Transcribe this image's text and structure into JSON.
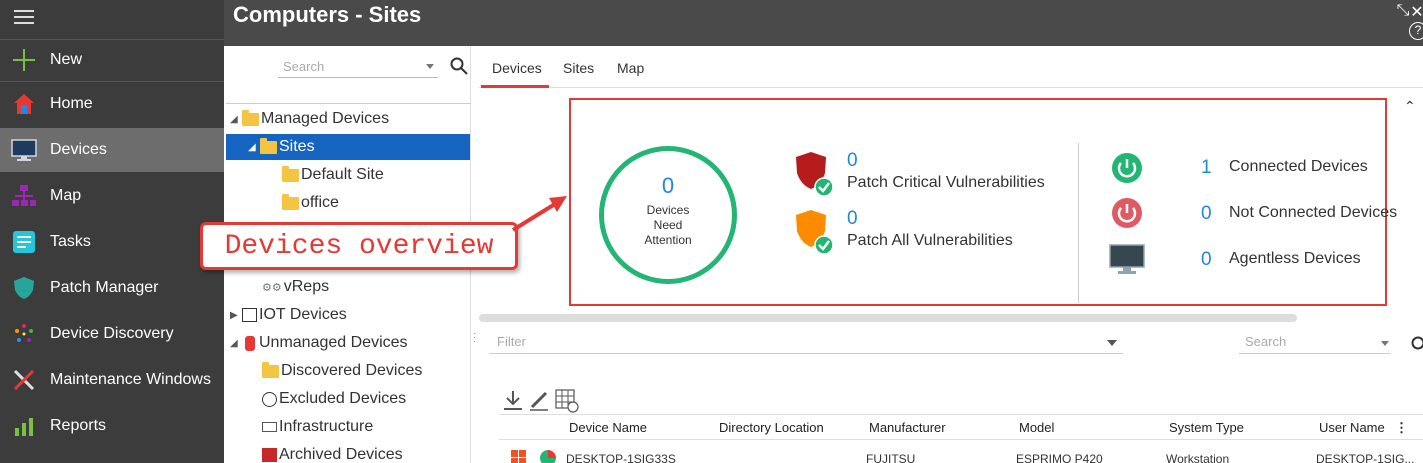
{
  "header": {
    "title": "Computers - Sites",
    "minimize_glyph": "⤡",
    "close_glyph": "✕",
    "help_glyph": "?"
  },
  "sidebar": {
    "new_label": "New",
    "items": [
      {
        "label": "Home",
        "icon": "home-icon"
      },
      {
        "label": "Devices",
        "icon": "monitor-icon"
      },
      {
        "label": "Map",
        "icon": "map-icon"
      },
      {
        "label": "Tasks",
        "icon": "tasks-icon"
      },
      {
        "label": "Patch Manager",
        "icon": "shield-icon"
      },
      {
        "label": "Device Discovery",
        "icon": "discovery-icon"
      },
      {
        "label": "Maintenance Windows",
        "icon": "tools-icon"
      },
      {
        "label": "Reports",
        "icon": "reports-icon"
      }
    ]
  },
  "tree": {
    "search_placeholder": "Search",
    "nodes": [
      {
        "label": "Managed Devices"
      },
      {
        "label": "Sites"
      },
      {
        "label": "Default Site"
      },
      {
        "label": "office"
      },
      {
        "label": "vReps"
      },
      {
        "label": "IOT Devices"
      },
      {
        "label": "Unmanaged Devices"
      },
      {
        "label": "Discovered Devices"
      },
      {
        "label": "Excluded Devices"
      },
      {
        "label": "Infrastructure"
      },
      {
        "label": "Archived Devices"
      }
    ]
  },
  "tabs": [
    {
      "label": "Devices"
    },
    {
      "label": "Sites"
    },
    {
      "label": "Map"
    }
  ],
  "overview": {
    "attention_count": "0",
    "attention_label_1": "Devices",
    "attention_label_2": "Need",
    "attention_label_3": "Attention",
    "patch_critical_count": "0",
    "patch_critical_label": "Patch Critical Vulnerabilities",
    "patch_all_count": "0",
    "patch_all_label": "Patch All Vulnerabilities",
    "connected_count": "1",
    "connected_label": "Connected Devices",
    "not_connected_count": "0",
    "not_connected_label": "Not Connected Devices",
    "agentless_count": "0",
    "agentless_label": "Agentless Devices"
  },
  "callout": {
    "text": "Devices overview"
  },
  "grid": {
    "filter_placeholder": "Filter",
    "search_placeholder": "Search",
    "columns": [
      "Device Name",
      "Directory Location",
      "Manufacturer",
      "Model",
      "System Type",
      "User Name"
    ],
    "rows": [
      {
        "device_name": "DESKTOP-1SIG33S",
        "manufacturer": "FUJITSU",
        "model": "ESPRIMO P420",
        "system_type": "Workstation",
        "user_name": "DESKTOP-1SIG..."
      }
    ]
  },
  "colors": {
    "accent_red": "#e53935",
    "accent_blue": "#1e88e5",
    "green": "#22b573",
    "sidebar_bg": "#3c3c3c"
  }
}
